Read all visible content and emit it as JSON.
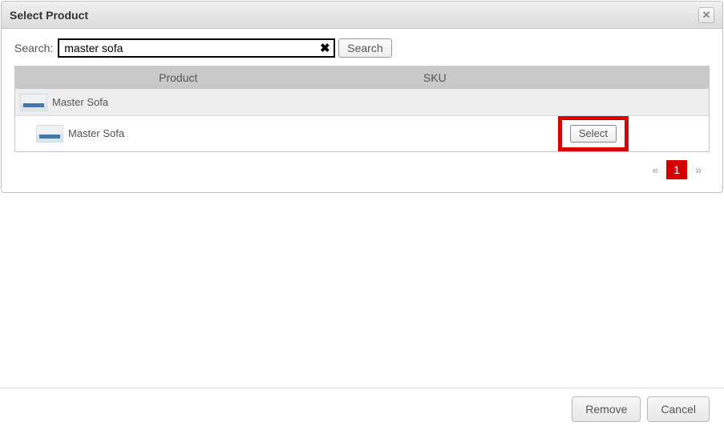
{
  "dialog": {
    "title": "Select Product"
  },
  "search": {
    "label": "Search:",
    "value": "master sofa",
    "button": "Search"
  },
  "table": {
    "headers": {
      "product": "Product",
      "sku": "SKU"
    },
    "group": {
      "name": "Master Sofa"
    },
    "items": [
      {
        "name": "Master Sofa",
        "select_label": "Select"
      }
    ]
  },
  "pagination": {
    "prev": "«",
    "current": "1",
    "next": "»"
  },
  "footer": {
    "remove": "Remove",
    "cancel": "Cancel"
  }
}
